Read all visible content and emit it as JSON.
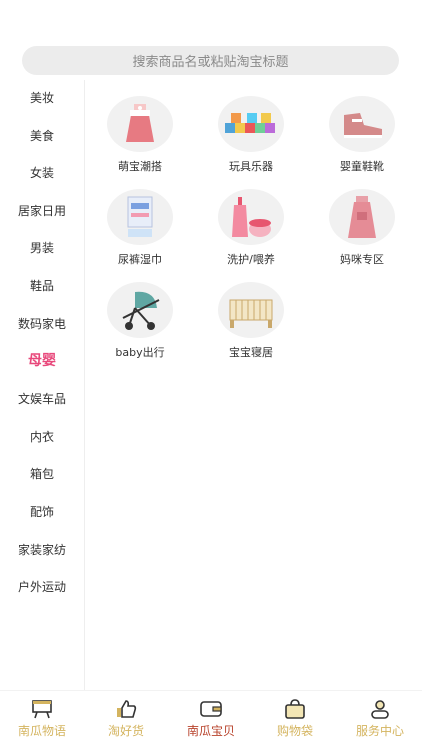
{
  "search": {
    "placeholder": "搜索商品名或粘贴淘宝标题"
  },
  "sidebar": {
    "active_index": 7,
    "items": [
      {
        "label": "美妆"
      },
      {
        "label": "美食"
      },
      {
        "label": "女装"
      },
      {
        "label": "居家日用"
      },
      {
        "label": "男装"
      },
      {
        "label": "鞋品"
      },
      {
        "label": "数码家电"
      },
      {
        "label": "母婴"
      },
      {
        "label": "文娱车品"
      },
      {
        "label": "内衣"
      },
      {
        "label": "箱包"
      },
      {
        "label": "配饰"
      },
      {
        "label": "家装家纺"
      },
      {
        "label": "户外运动"
      }
    ]
  },
  "categories": [
    {
      "label": "萌宝潮搭",
      "icon": "baby-dress-icon"
    },
    {
      "label": "玩具乐器",
      "icon": "toy-blocks-icon"
    },
    {
      "label": "婴童鞋靴",
      "icon": "baby-shoe-icon"
    },
    {
      "label": "尿裤湿巾",
      "icon": "diaper-wipes-icon"
    },
    {
      "label": "洗护/喂养",
      "icon": "baby-lotion-icon"
    },
    {
      "label": "妈咪专区",
      "icon": "maternity-dress-icon"
    },
    {
      "label": "baby出行",
      "icon": "stroller-icon"
    },
    {
      "label": "宝宝寝居",
      "icon": "crib-icon"
    }
  ],
  "tabbar": {
    "active_index": 2,
    "tabs": [
      {
        "label": "南瓜物语",
        "icon": "easel-icon"
      },
      {
        "label": "淘好货",
        "icon": "thumbs-up-icon"
      },
      {
        "label": "南瓜宝贝",
        "icon": "wallet-icon"
      },
      {
        "label": "购物袋",
        "icon": "shopping-bag-icon"
      },
      {
        "label": "服务中心",
        "icon": "person-icon"
      }
    ]
  },
  "colors": {
    "accent": "#e8487b",
    "tab_default": "#d4b45f",
    "tab_active": "#b8432c"
  }
}
